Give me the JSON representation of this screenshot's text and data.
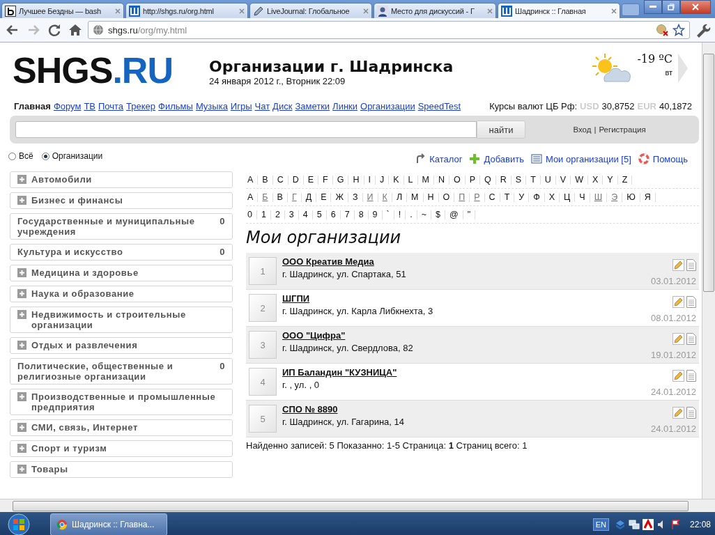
{
  "browser": {
    "tabs": [
      {
        "kind": "letter",
        "title": "Лучшее Бездны — bash",
        "selected": false
      },
      {
        "kind": "site",
        "title": "http://shgs.ru/org.html",
        "selected": false
      },
      {
        "kind": "pen",
        "title": "LiveJournal: Глобальное",
        "selected": false
      },
      {
        "kind": "person",
        "title": "Место для дискуссий - Г",
        "selected": false
      },
      {
        "kind": "site",
        "title": "Шадринск :: Главная",
        "selected": true
      }
    ],
    "address": {
      "host": "shgs.ru",
      "path": "/org/my.html"
    }
  },
  "header": {
    "logo": {
      "text": "SHGS",
      "accent": ".RU"
    },
    "title": "Организации г. Шадринска",
    "date": "24 января 2012 г., Вторник 22:09",
    "weather": {
      "temperature": "-19 ºC",
      "day": "вт"
    },
    "nav": [
      {
        "label": "Главная",
        "selected": true
      },
      {
        "label": "Форум",
        "selected": false
      },
      {
        "label": "ТВ",
        "selected": false
      },
      {
        "label": "Почта",
        "selected": false
      },
      {
        "label": "Трекер",
        "selected": false
      },
      {
        "label": "Фильмы",
        "selected": false
      },
      {
        "label": "Музыка",
        "selected": false
      },
      {
        "label": "Игры",
        "selected": false
      },
      {
        "label": "Чат",
        "selected": false
      },
      {
        "label": "Диск",
        "selected": false
      },
      {
        "label": "Заметки",
        "selected": false
      },
      {
        "label": "Линки",
        "selected": false
      },
      {
        "label": "Организации",
        "selected": false
      },
      {
        "label": "SpeedTest",
        "selected": false
      }
    ],
    "rates": {
      "label": "Курсы валют ЦБ Рф:",
      "items": [
        {
          "code": "USD",
          "value": "30,8752"
        },
        {
          "code": "EUR",
          "value": "40,1872"
        }
      ]
    }
  },
  "search": {
    "button": "найти",
    "login": "Вход",
    "register": "Регистрация",
    "separator": "|"
  },
  "scope": [
    {
      "label": "Всё",
      "selected": false
    },
    {
      "label": "Организации",
      "selected": true
    }
  ],
  "actions": [
    {
      "kind": "catalog",
      "label": "Каталог"
    },
    {
      "kind": "add",
      "label": "Добавить"
    },
    {
      "kind": "mine",
      "label": "Мои организации [5]"
    },
    {
      "kind": "help",
      "label": "Помощь"
    }
  ],
  "categories": [
    {
      "label": "Автомобили",
      "expandable": true
    },
    {
      "label": "Бизнес и финансы",
      "expandable": true
    },
    {
      "label": "Государственные и муниципальные учреждения",
      "expandable": false,
      "count": "0"
    },
    {
      "label": "Культура и искусство",
      "expandable": false,
      "count": "0"
    },
    {
      "label": "Медицина и здоровье",
      "expandable": true
    },
    {
      "label": "Наука и образование",
      "expandable": true
    },
    {
      "label": "Недвижимость и строительные организации",
      "expandable": true
    },
    {
      "label": "Отдых и развлечения",
      "expandable": true
    },
    {
      "label": "Политические, общественные и религиозные организации",
      "expandable": false,
      "count": "0"
    },
    {
      "label": "Производственные и промышленные предприятия",
      "expandable": true
    },
    {
      "label": "СМИ, связь, Интернет",
      "expandable": true
    },
    {
      "label": "Спорт и туризм",
      "expandable": true
    },
    {
      "label": "Товары",
      "expandable": true
    }
  ],
  "alphabet": [
    [
      {
        "ch": "A",
        "linked": false
      },
      {
        "ch": "B",
        "linked": false
      },
      {
        "ch": "C",
        "linked": false
      },
      {
        "ch": "D",
        "linked": false
      },
      {
        "ch": "E",
        "linked": false
      },
      {
        "ch": "F",
        "linked": false
      },
      {
        "ch": "G",
        "linked": false
      },
      {
        "ch": "H",
        "linked": false
      },
      {
        "ch": "I",
        "linked": false
      },
      {
        "ch": "J",
        "linked": false
      },
      {
        "ch": "K",
        "linked": false
      },
      {
        "ch": "L",
        "linked": false
      },
      {
        "ch": "M",
        "linked": false
      },
      {
        "ch": "N",
        "linked": false
      },
      {
        "ch": "O",
        "linked": false
      },
      {
        "ch": "P",
        "linked": false
      },
      {
        "ch": "Q",
        "linked": false
      },
      {
        "ch": "R",
        "linked": false
      },
      {
        "ch": "S",
        "linked": false
      },
      {
        "ch": "T",
        "linked": false
      },
      {
        "ch": "U",
        "linked": false
      },
      {
        "ch": "V",
        "linked": false
      },
      {
        "ch": "W",
        "linked": false
      },
      {
        "ch": "X",
        "linked": false
      },
      {
        "ch": "Y",
        "linked": false
      },
      {
        "ch": "Z",
        "linked": false
      }
    ],
    [
      {
        "ch": "А",
        "linked": false
      },
      {
        "ch": "Б",
        "linked": true
      },
      {
        "ch": "В",
        "linked": false
      },
      {
        "ch": "Г",
        "linked": true
      },
      {
        "ch": "Д",
        "linked": false
      },
      {
        "ch": "Е",
        "linked": false
      },
      {
        "ch": "Ж",
        "linked": false
      },
      {
        "ch": "З",
        "linked": false
      },
      {
        "ch": "И",
        "linked": true
      },
      {
        "ch": "К",
        "linked": true
      },
      {
        "ch": "Л",
        "linked": false
      },
      {
        "ch": "М",
        "linked": false
      },
      {
        "ch": "Н",
        "linked": false
      },
      {
        "ch": "О",
        "linked": false
      },
      {
        "ch": "П",
        "linked": true
      },
      {
        "ch": "Р",
        "linked": true
      },
      {
        "ch": "С",
        "linked": false
      },
      {
        "ch": "Т",
        "linked": false
      },
      {
        "ch": "У",
        "linked": false
      },
      {
        "ch": "Ф",
        "linked": false
      },
      {
        "ch": "Х",
        "linked": false
      },
      {
        "ch": "Ц",
        "linked": false
      },
      {
        "ch": "Ч",
        "linked": false
      },
      {
        "ch": "Ш",
        "linked": true
      },
      {
        "ch": "Э",
        "linked": true
      },
      {
        "ch": "Ю",
        "linked": false
      },
      {
        "ch": "Я",
        "linked": false
      }
    ],
    [
      {
        "ch": "0",
        "linked": false
      },
      {
        "ch": "1",
        "linked": false
      },
      {
        "ch": "2",
        "linked": false
      },
      {
        "ch": "3",
        "linked": false
      },
      {
        "ch": "4",
        "linked": false
      },
      {
        "ch": "5",
        "linked": false
      },
      {
        "ch": "6",
        "linked": false
      },
      {
        "ch": "7",
        "linked": false
      },
      {
        "ch": "8",
        "linked": false
      },
      {
        "ch": "9",
        "linked": false
      },
      {
        "ch": "`",
        "linked": false
      },
      {
        "ch": "!",
        "linked": false
      },
      {
        "ch": ".",
        "linked": false
      },
      {
        "ch": "~",
        "linked": false
      },
      {
        "ch": "$",
        "linked": false
      },
      {
        "ch": "@",
        "linked": false
      },
      {
        "ch": "\"",
        "linked": false
      }
    ]
  ],
  "heading": "Мои организации",
  "organizations": [
    {
      "number": "1",
      "name": "ООО Креатив Медиа",
      "address": "г. Шадринск, ул. Спартака, 51",
      "date": "03.01.2012"
    },
    {
      "number": "2",
      "name": "ШГПИ",
      "address": "г. Шадринск, ул. Карла Либкнехта, 3",
      "date": "08.01.2012"
    },
    {
      "number": "3",
      "name": "ООО \"Цифра\"",
      "address": "г. Шадринск, ул. Свердлова, 82",
      "date": "19.01.2012"
    },
    {
      "number": "4",
      "name": "ИП Баландин \"КУЗНИЦА\"",
      "address": "г. , ул. , 0",
      "date": "24.01.2012"
    },
    {
      "number": "5",
      "name": "СПО № 8890",
      "address": "г. Шадринск, ул. Гагарина, 14",
      "date": "24.01.2012"
    }
  ],
  "summary": "Найденно записей: 5 Показанно: 1-5 Страница: **1** Страниц всего: 1",
  "taskbar": {
    "task": "Шадринск :: Главна...",
    "language": "EN",
    "time": "22:08"
  }
}
